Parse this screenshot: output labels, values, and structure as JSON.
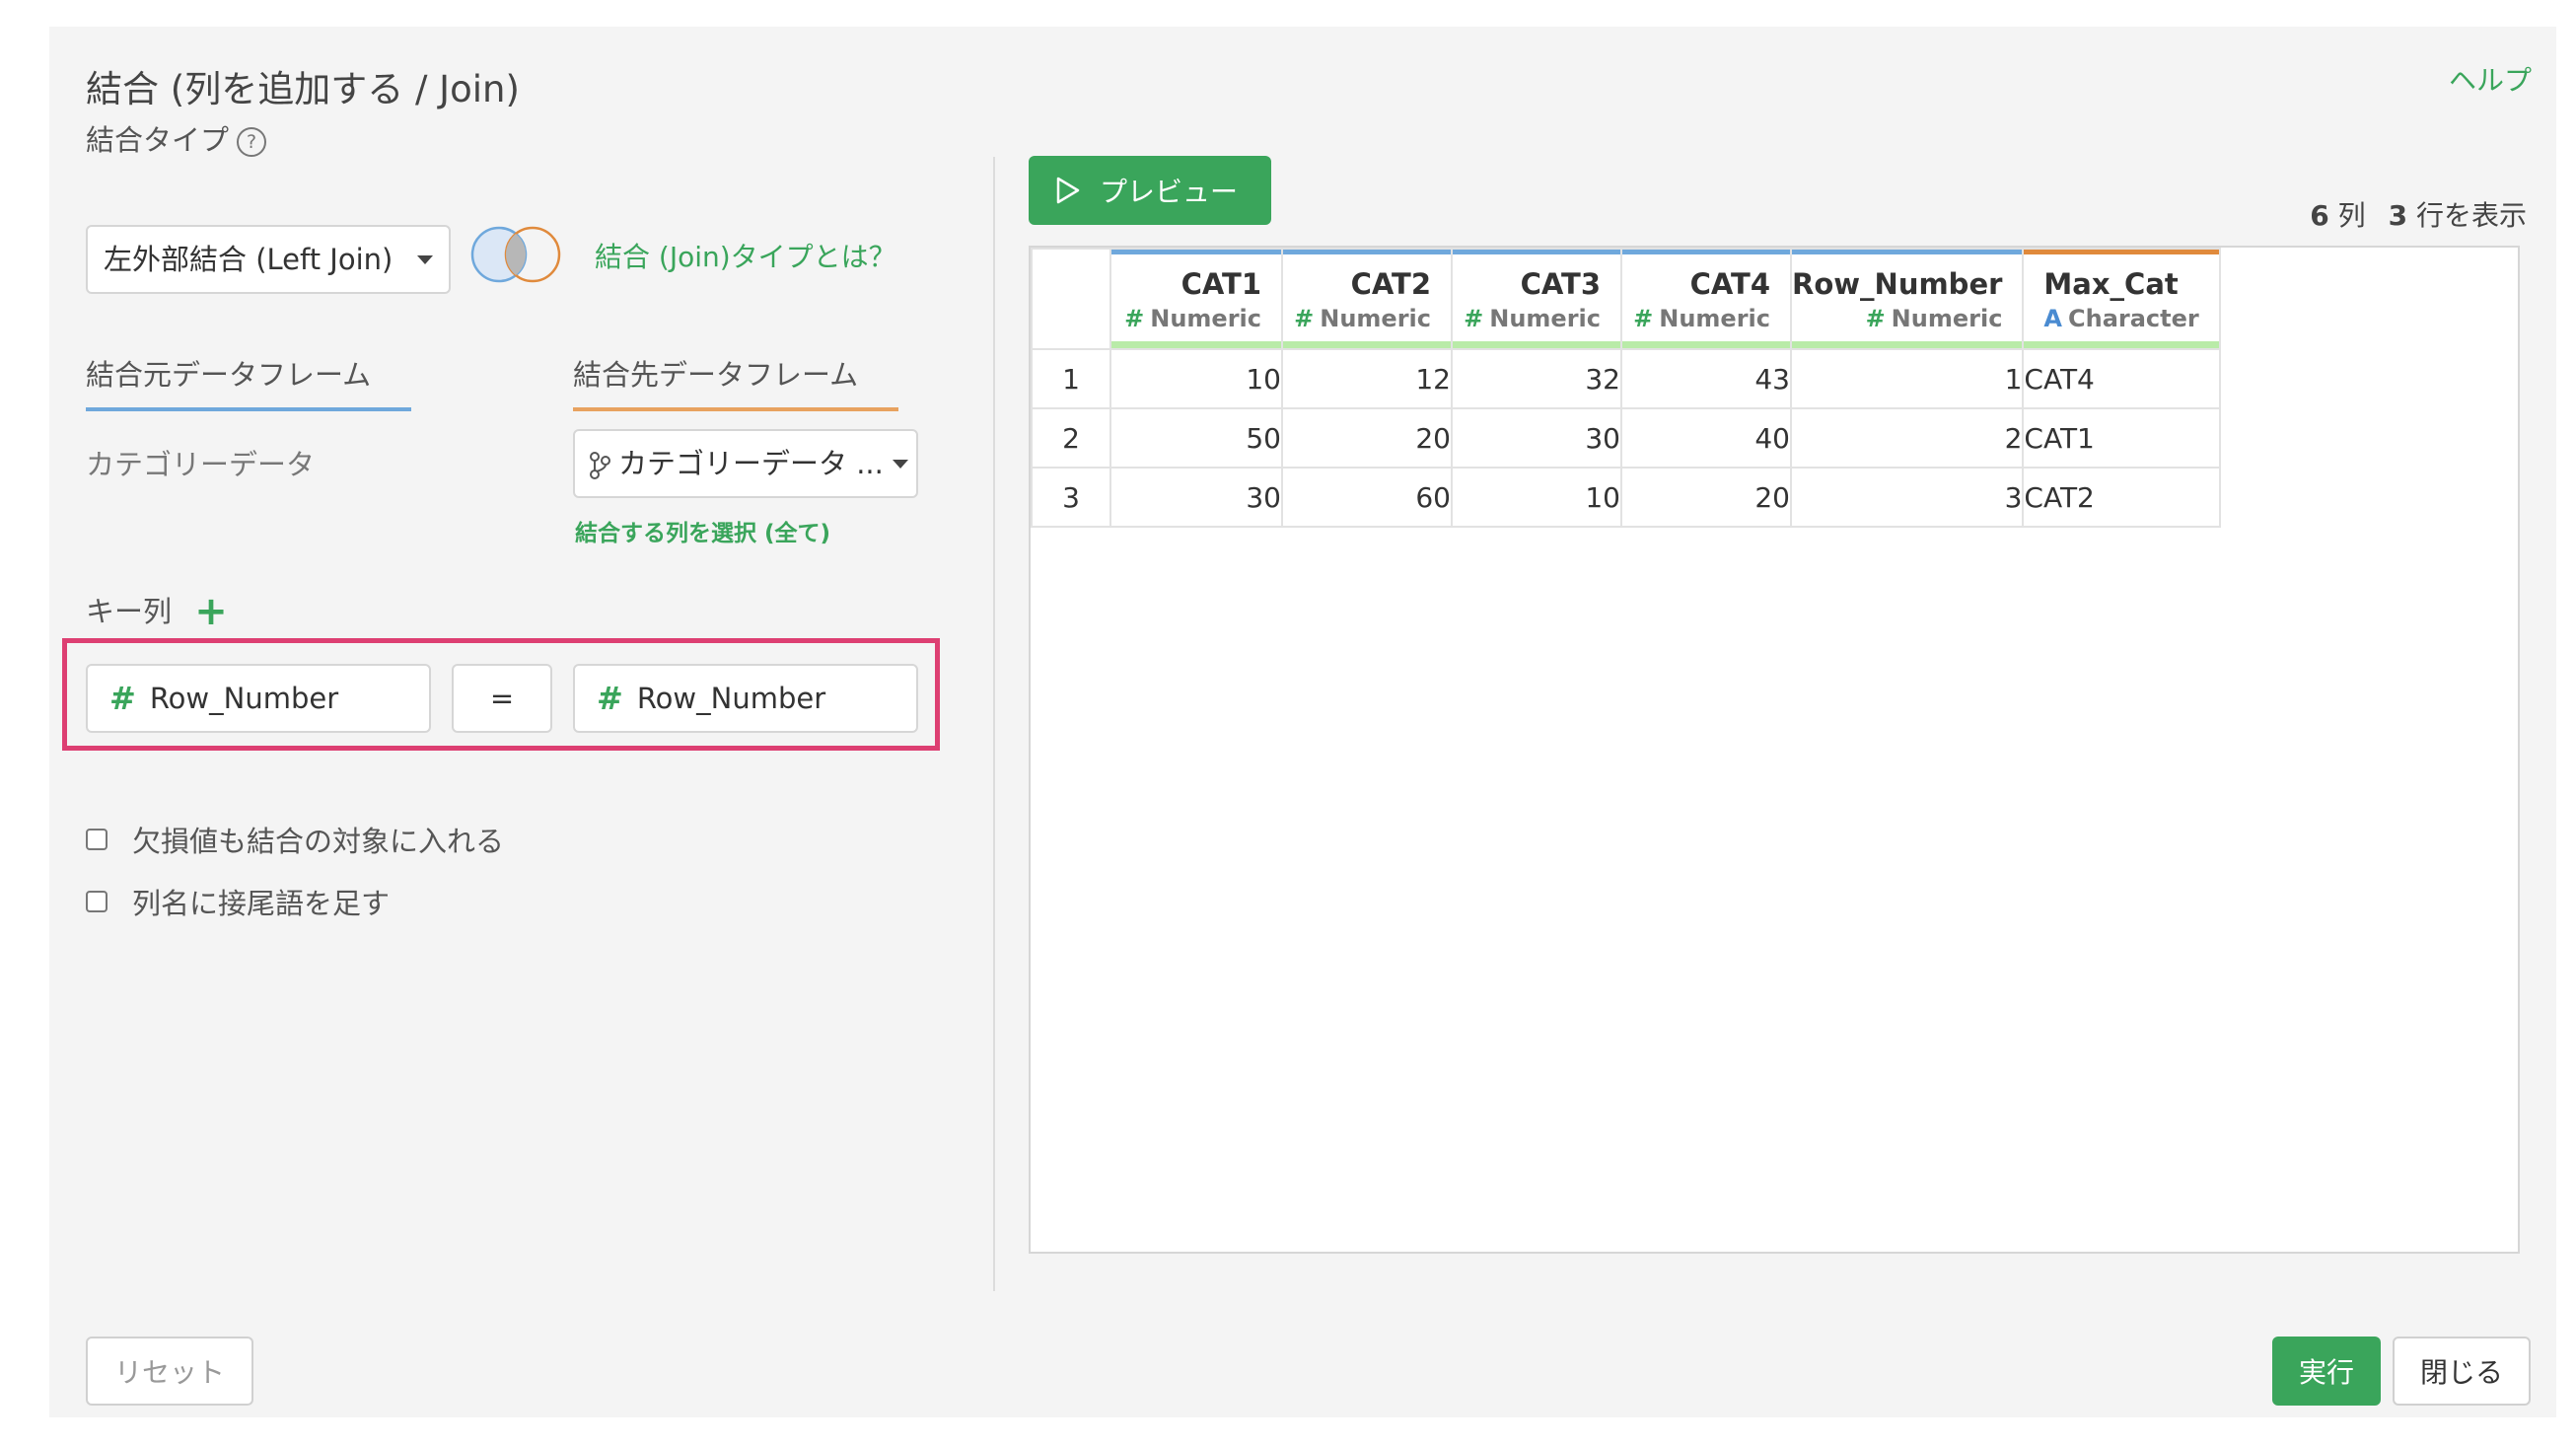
{
  "dialog": {
    "title": "結合 (列を追加する / Join)",
    "help_link": "ヘルプ"
  },
  "left": {
    "join_type_label": "結合タイプ",
    "join_type_help_icon": "question-circle-icon",
    "join_type_value": "左外部結合 (Left Join)",
    "join_type_link": "結合 (Join)タイプとは？",
    "source_tab_label": "結合元データフレーム",
    "target_tab_label": "結合先データフレーム",
    "source_df_name": "カテゴリーデータ",
    "target_df_value": "カテゴリーデータ ...",
    "select_columns_link": "結合する列を選択 (全て)",
    "key_columns_label": "キー列",
    "add_key_icon": "plus-icon",
    "key_left": "Row_Number",
    "key_operator": "=",
    "key_right": "Row_Number",
    "option_include_na": "欠損値も結合の対象に入れる",
    "option_add_suffix": "列名に接尾語を足す",
    "reset_button": "リセット"
  },
  "preview": {
    "button_label": "プレビュー",
    "summary_cols_count": "6",
    "summary_cols_unit": "列",
    "summary_rows_count": "3",
    "summary_rows_unit": "行を表示",
    "columns": [
      {
        "name": "CAT1",
        "type": "Numeric",
        "type_icon": "#"
      },
      {
        "name": "CAT2",
        "type": "Numeric",
        "type_icon": "#"
      },
      {
        "name": "CAT3",
        "type": "Numeric",
        "type_icon": "#"
      },
      {
        "name": "CAT4",
        "type": "Numeric",
        "type_icon": "#"
      },
      {
        "name": "Row_Number",
        "type": "Numeric",
        "type_icon": "#"
      },
      {
        "name": "Max_Cat",
        "type": "Character",
        "type_icon": "A"
      }
    ],
    "rows": [
      {
        "index": "1",
        "cells": [
          "10",
          "12",
          "32",
          "43",
          "1",
          "CAT4"
        ]
      },
      {
        "index": "2",
        "cells": [
          "50",
          "20",
          "30",
          "40",
          "2",
          "CAT1"
        ]
      },
      {
        "index": "3",
        "cells": [
          "30",
          "60",
          "10",
          "20",
          "3",
          "CAT2"
        ]
      }
    ]
  },
  "footer": {
    "run_button": "実行",
    "close_button": "閉じる"
  },
  "colors": {
    "accent_green": "#3aa55b",
    "highlight_border": "#dd3f72",
    "numeric_header_bar": "#6fa8dc",
    "character_header_bar": "#e08a3c"
  }
}
